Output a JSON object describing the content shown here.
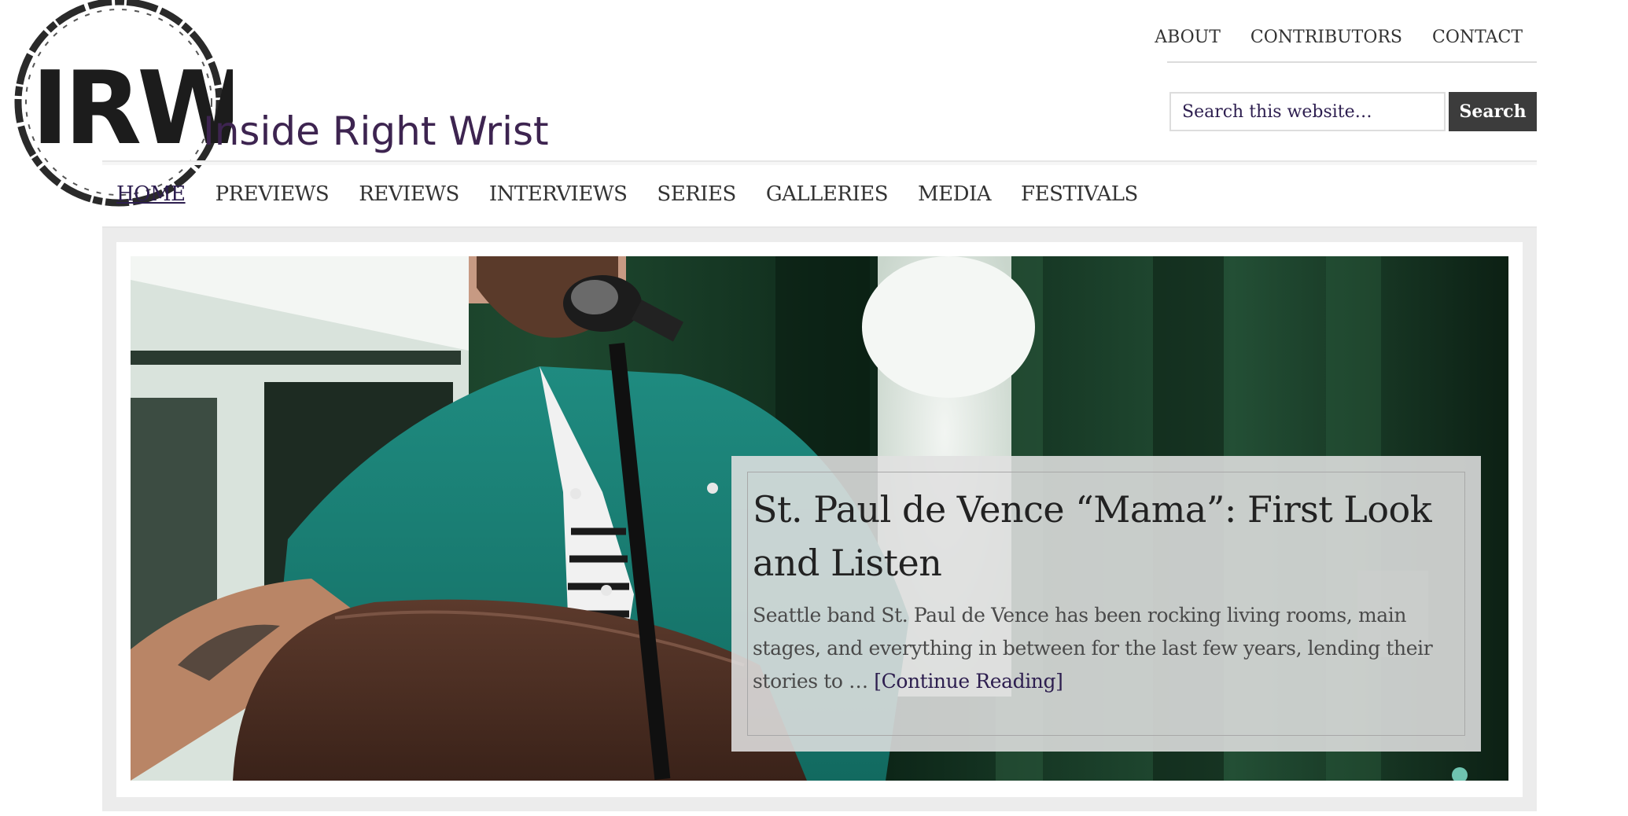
{
  "site": {
    "logo_text": "IRW",
    "title": "Inside Right Wrist"
  },
  "top_nav": {
    "items": [
      {
        "label": "ABOUT"
      },
      {
        "label": "CONTRIBUTORS"
      },
      {
        "label": "CONTACT"
      }
    ]
  },
  "search": {
    "placeholder": "Search this website…",
    "button_label": "Search"
  },
  "primary_nav": {
    "items": [
      {
        "label": "HOME",
        "current": true
      },
      {
        "label": "PREVIEWS"
      },
      {
        "label": "REVIEWS"
      },
      {
        "label": "INTERVIEWS"
      },
      {
        "label": "SERIES"
      },
      {
        "label": "GALLERIES"
      },
      {
        "label": "MEDIA"
      },
      {
        "label": "FESTIVALS"
      }
    ]
  },
  "featured": {
    "title": "St. Paul de Vence “Mama”: First Look and Listen",
    "excerpt": "Seattle band St. Paul de Vence has been rocking living rooms, main stages, and everything in between for the last few years, lending their stories to … ",
    "read_more": "[Continue Reading]"
  },
  "colors": {
    "brand_purple": "#3d2450",
    "link": "#2d1e4f",
    "search_button": "#3c3c3c",
    "frame": "#ececec"
  }
}
